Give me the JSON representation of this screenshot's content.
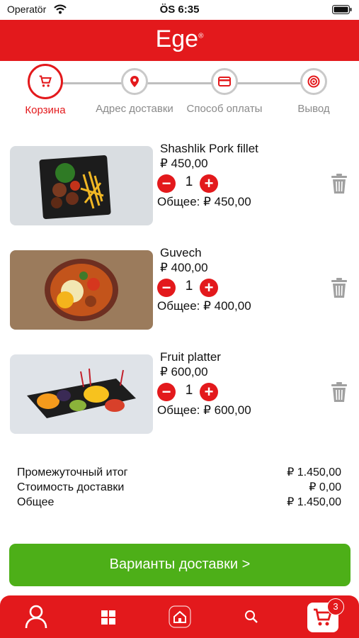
{
  "status": {
    "carrier": "Operatör",
    "time": "ÖS 6:35"
  },
  "header": {
    "logo": "Ege",
    "logo_mark": "®"
  },
  "steps": [
    {
      "label": "Корзина",
      "icon": "cart-icon"
    },
    {
      "label": "Адрес доставки",
      "icon": "location-pin-icon"
    },
    {
      "label": "Способ оплаты",
      "icon": "credit-card-icon"
    },
    {
      "label": "Вывод",
      "icon": "target-icon"
    }
  ],
  "cart": {
    "items": [
      {
        "name": "Shashlik Pork fillet",
        "price": "₽ 450,00",
        "qty": "1",
        "total": "Общее: ₽ 450,00"
      },
      {
        "name": "Guvech",
        "price": "₽ 400,00",
        "qty": "1",
        "total": "Общее: ₽ 400,00"
      },
      {
        "name": "Fruit platter",
        "price": "₽ 600,00",
        "qty": "1",
        "total": "Общее: ₽ 600,00"
      }
    ]
  },
  "summary": {
    "subtotal_label": "Промежуточный итог",
    "subtotal_value": "₽ 1.450,00",
    "delivery_label": "Стоимость доставки",
    "delivery_value": "₽ 0,00",
    "total_label": "Общее",
    "total_value": "₽ 1.450,00"
  },
  "cta": {
    "label": "Варианты доставки >"
  },
  "tabbar": {
    "cart_count": "3"
  },
  "colors": {
    "brand_red": "#e3191c",
    "cta_green": "#4daf18"
  }
}
